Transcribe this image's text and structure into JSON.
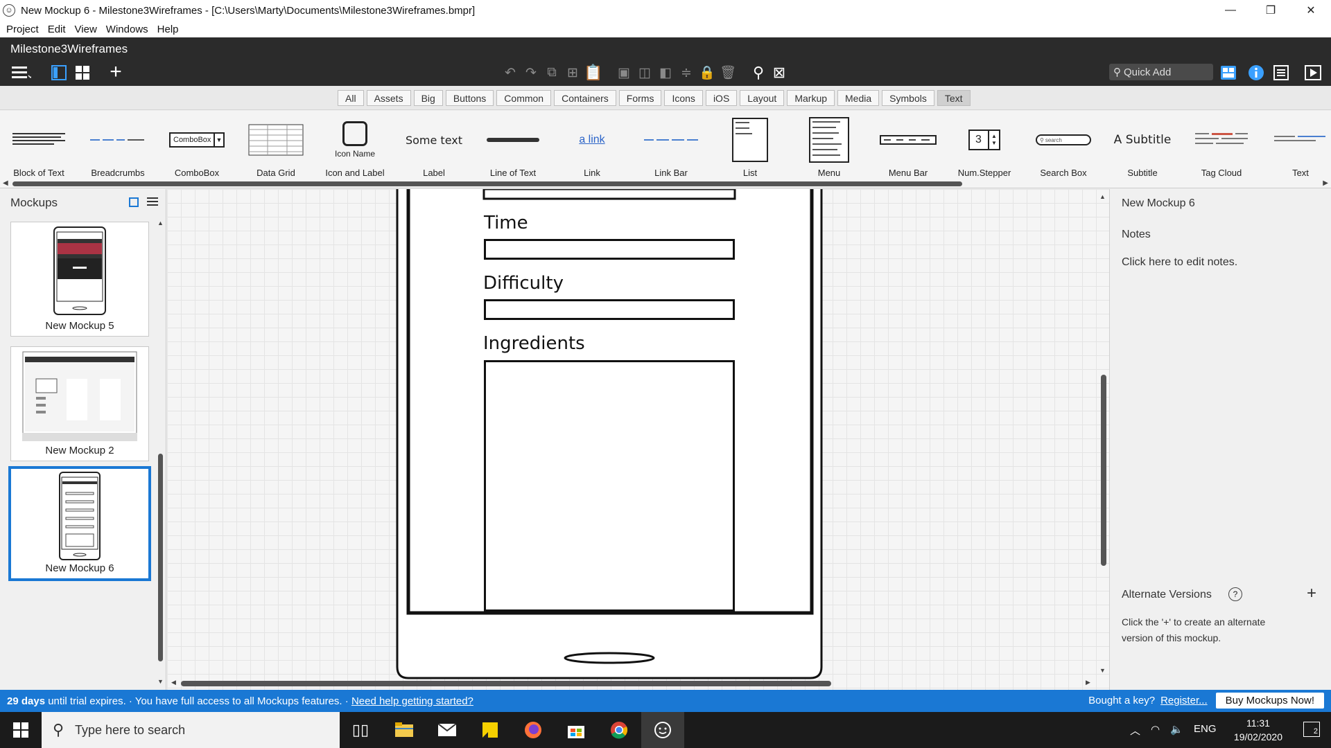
{
  "window": {
    "title": "New Mockup 6 - Milestone3Wireframes - [C:\\Users\\Marty\\Documents\\Milestone3Wireframes.bmpr]",
    "controls": {
      "minimize": "—",
      "restore": "❐",
      "close": "✕"
    }
  },
  "menu": [
    "Project",
    "Edit",
    "View",
    "Windows",
    "Help"
  ],
  "toolbar": {
    "project_name": "Milestone3Wireframes",
    "quick_add_placeholder": "Quick Add"
  },
  "filters": [
    "All",
    "Assets",
    "Big",
    "Buttons",
    "Common",
    "Containers",
    "Forms",
    "Icons",
    "iOS",
    "Layout",
    "Markup",
    "Media",
    "Symbols",
    "Text"
  ],
  "active_filter": "Text",
  "library": {
    "items": [
      {
        "label": "Block of Text"
      },
      {
        "label": "Breadcrumbs"
      },
      {
        "label": "ComboBox",
        "sample": "ComboBox"
      },
      {
        "label": "Data Grid"
      },
      {
        "label": "Icon and Label",
        "sample": "Icon Name"
      },
      {
        "label": "Label",
        "sample": "Some text"
      },
      {
        "label": "Line of Text"
      },
      {
        "label": "Link",
        "sample": "a link"
      },
      {
        "label": "Link Bar"
      },
      {
        "label": "List"
      },
      {
        "label": "Menu"
      },
      {
        "label": "Menu Bar"
      },
      {
        "label": "Num.Stepper",
        "sample": "3"
      },
      {
        "label": "Search Box",
        "sample": "search"
      },
      {
        "label": "Subtitle",
        "sample": "A Subtitle"
      },
      {
        "label": "Tag Cloud"
      },
      {
        "label": "Text"
      }
    ]
  },
  "mockups_panel": {
    "title": "Mockups",
    "items": [
      {
        "name": "New Mockup 5",
        "selected": false
      },
      {
        "name": "New Mockup 2",
        "selected": false
      },
      {
        "name": "New Mockup 6",
        "selected": true
      }
    ]
  },
  "canvas": {
    "labels": {
      "time": "Time",
      "difficulty": "Difficulty",
      "ingredients": "Ingredients"
    }
  },
  "properties": {
    "mockup_name": "New Mockup 6",
    "notes_title": "Notes",
    "notes_hint": "Click here to edit notes.",
    "alt_title": "Alternate Versions",
    "alt_help": "?",
    "alt_hint_line1": "Click the '+' to create an alternate",
    "alt_hint_line2": "version of this mockup."
  },
  "status": {
    "days": "29 days",
    "trial_text": " until trial expires.  ·  You have full access to all Mockups features.  ·  ",
    "help_link": "Need help getting started?",
    "key_text": "Bought a key?",
    "register_link": "Register...",
    "buy_button": "Buy Mockups Now!"
  },
  "taskbar": {
    "search_placeholder": "Type here to search",
    "language": "ENG",
    "time": "11:31",
    "date": "19/02/2020",
    "notifications": "2"
  },
  "colors": {
    "accent": "#1a78d4",
    "toolbar_bg": "#2b2b2b",
    "taskbar_bg": "#1b1b1b"
  }
}
